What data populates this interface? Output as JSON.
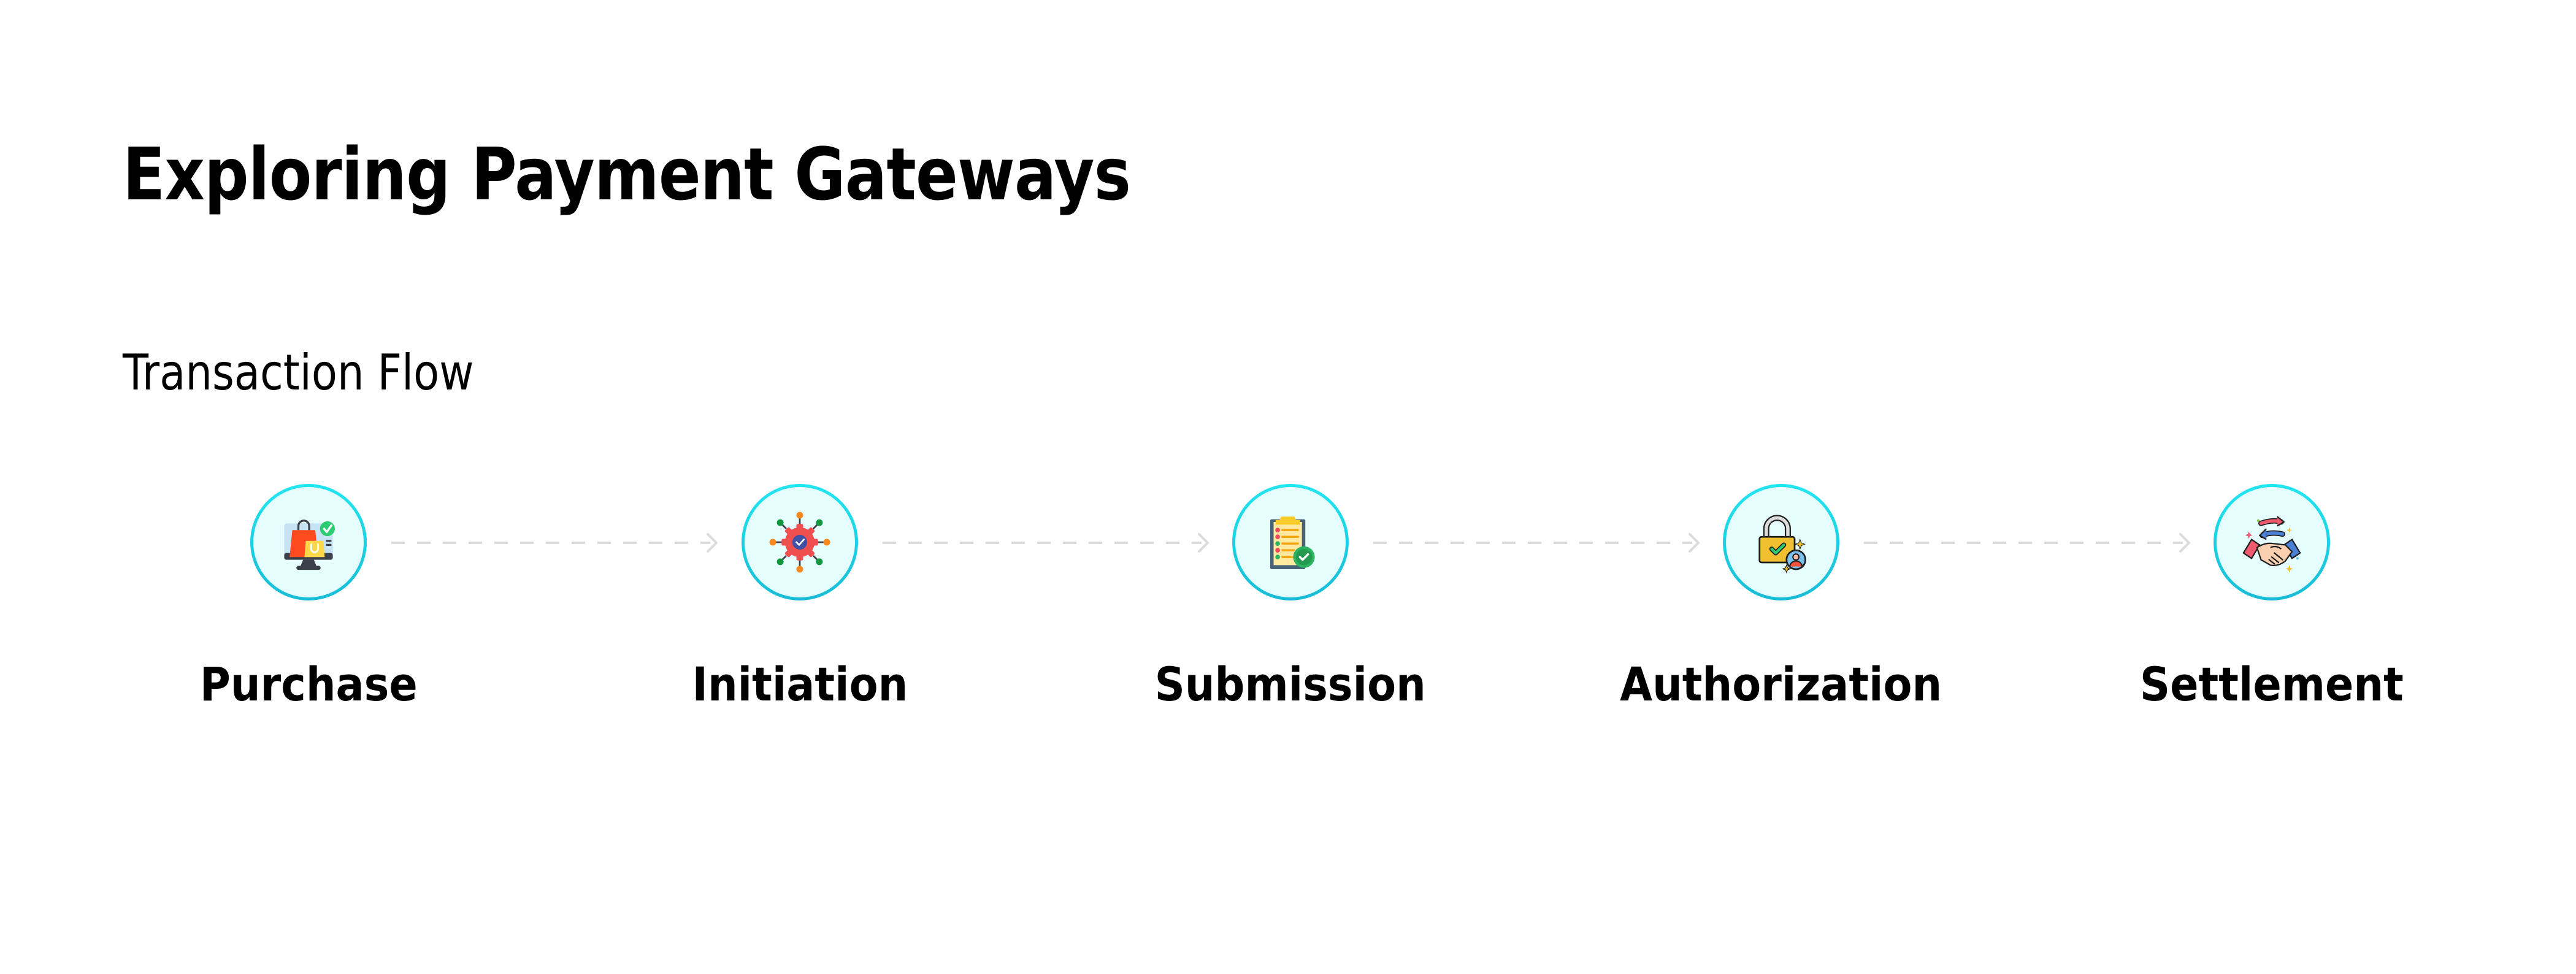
{
  "page": {
    "title": "Exploring Payment Gateways",
    "subtitle": "Transaction Flow"
  },
  "flow": {
    "steps": [
      {
        "label": "Purchase",
        "icon": "shopping-bags-monitor-icon"
      },
      {
        "label": "Initiation",
        "icon": "gear-network-check-icon"
      },
      {
        "label": "Submission",
        "icon": "clipboard-checklist-icon"
      },
      {
        "label": "Authorization",
        "icon": "unlocked-padlock-user-icon"
      },
      {
        "label": "Settlement",
        "icon": "handshake-exchange-icon"
      }
    ],
    "connector_style": "dashed-arrow"
  },
  "colors": {
    "circle_fill": "#e6fdfe",
    "circle_border_top": "#22e6f2",
    "circle_border_bottom": "#18bcd6",
    "connector": "#dcdcdc",
    "text": "#000000"
  }
}
